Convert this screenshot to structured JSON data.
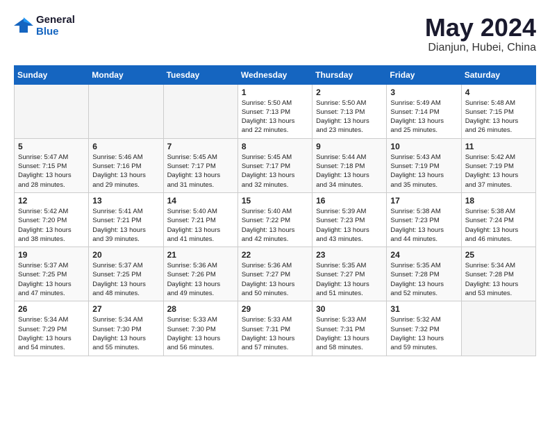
{
  "logo": {
    "line1": "General",
    "line2": "Blue"
  },
  "title": "May 2024",
  "location": "Dianjun, Hubei, China",
  "days_of_week": [
    "Sunday",
    "Monday",
    "Tuesday",
    "Wednesday",
    "Thursday",
    "Friday",
    "Saturday"
  ],
  "weeks": [
    [
      {
        "day": "",
        "info": ""
      },
      {
        "day": "",
        "info": ""
      },
      {
        "day": "",
        "info": ""
      },
      {
        "day": "1",
        "info": "Sunrise: 5:50 AM\nSunset: 7:13 PM\nDaylight: 13 hours\nand 22 minutes."
      },
      {
        "day": "2",
        "info": "Sunrise: 5:50 AM\nSunset: 7:13 PM\nDaylight: 13 hours\nand 23 minutes."
      },
      {
        "day": "3",
        "info": "Sunrise: 5:49 AM\nSunset: 7:14 PM\nDaylight: 13 hours\nand 25 minutes."
      },
      {
        "day": "4",
        "info": "Sunrise: 5:48 AM\nSunset: 7:15 PM\nDaylight: 13 hours\nand 26 minutes."
      }
    ],
    [
      {
        "day": "5",
        "info": "Sunrise: 5:47 AM\nSunset: 7:15 PM\nDaylight: 13 hours\nand 28 minutes."
      },
      {
        "day": "6",
        "info": "Sunrise: 5:46 AM\nSunset: 7:16 PM\nDaylight: 13 hours\nand 29 minutes."
      },
      {
        "day": "7",
        "info": "Sunrise: 5:45 AM\nSunset: 7:17 PM\nDaylight: 13 hours\nand 31 minutes."
      },
      {
        "day": "8",
        "info": "Sunrise: 5:45 AM\nSunset: 7:17 PM\nDaylight: 13 hours\nand 32 minutes."
      },
      {
        "day": "9",
        "info": "Sunrise: 5:44 AM\nSunset: 7:18 PM\nDaylight: 13 hours\nand 34 minutes."
      },
      {
        "day": "10",
        "info": "Sunrise: 5:43 AM\nSunset: 7:19 PM\nDaylight: 13 hours\nand 35 minutes."
      },
      {
        "day": "11",
        "info": "Sunrise: 5:42 AM\nSunset: 7:19 PM\nDaylight: 13 hours\nand 37 minutes."
      }
    ],
    [
      {
        "day": "12",
        "info": "Sunrise: 5:42 AM\nSunset: 7:20 PM\nDaylight: 13 hours\nand 38 minutes."
      },
      {
        "day": "13",
        "info": "Sunrise: 5:41 AM\nSunset: 7:21 PM\nDaylight: 13 hours\nand 39 minutes."
      },
      {
        "day": "14",
        "info": "Sunrise: 5:40 AM\nSunset: 7:21 PM\nDaylight: 13 hours\nand 41 minutes."
      },
      {
        "day": "15",
        "info": "Sunrise: 5:40 AM\nSunset: 7:22 PM\nDaylight: 13 hours\nand 42 minutes."
      },
      {
        "day": "16",
        "info": "Sunrise: 5:39 AM\nSunset: 7:23 PM\nDaylight: 13 hours\nand 43 minutes."
      },
      {
        "day": "17",
        "info": "Sunrise: 5:38 AM\nSunset: 7:23 PM\nDaylight: 13 hours\nand 44 minutes."
      },
      {
        "day": "18",
        "info": "Sunrise: 5:38 AM\nSunset: 7:24 PM\nDaylight: 13 hours\nand 46 minutes."
      }
    ],
    [
      {
        "day": "19",
        "info": "Sunrise: 5:37 AM\nSunset: 7:25 PM\nDaylight: 13 hours\nand 47 minutes."
      },
      {
        "day": "20",
        "info": "Sunrise: 5:37 AM\nSunset: 7:25 PM\nDaylight: 13 hours\nand 48 minutes."
      },
      {
        "day": "21",
        "info": "Sunrise: 5:36 AM\nSunset: 7:26 PM\nDaylight: 13 hours\nand 49 minutes."
      },
      {
        "day": "22",
        "info": "Sunrise: 5:36 AM\nSunset: 7:27 PM\nDaylight: 13 hours\nand 50 minutes."
      },
      {
        "day": "23",
        "info": "Sunrise: 5:35 AM\nSunset: 7:27 PM\nDaylight: 13 hours\nand 51 minutes."
      },
      {
        "day": "24",
        "info": "Sunrise: 5:35 AM\nSunset: 7:28 PM\nDaylight: 13 hours\nand 52 minutes."
      },
      {
        "day": "25",
        "info": "Sunrise: 5:34 AM\nSunset: 7:28 PM\nDaylight: 13 hours\nand 53 minutes."
      }
    ],
    [
      {
        "day": "26",
        "info": "Sunrise: 5:34 AM\nSunset: 7:29 PM\nDaylight: 13 hours\nand 54 minutes."
      },
      {
        "day": "27",
        "info": "Sunrise: 5:34 AM\nSunset: 7:30 PM\nDaylight: 13 hours\nand 55 minutes."
      },
      {
        "day": "28",
        "info": "Sunrise: 5:33 AM\nSunset: 7:30 PM\nDaylight: 13 hours\nand 56 minutes."
      },
      {
        "day": "29",
        "info": "Sunrise: 5:33 AM\nSunset: 7:31 PM\nDaylight: 13 hours\nand 57 minutes."
      },
      {
        "day": "30",
        "info": "Sunrise: 5:33 AM\nSunset: 7:31 PM\nDaylight: 13 hours\nand 58 minutes."
      },
      {
        "day": "31",
        "info": "Sunrise: 5:32 AM\nSunset: 7:32 PM\nDaylight: 13 hours\nand 59 minutes."
      },
      {
        "day": "",
        "info": ""
      }
    ]
  ]
}
